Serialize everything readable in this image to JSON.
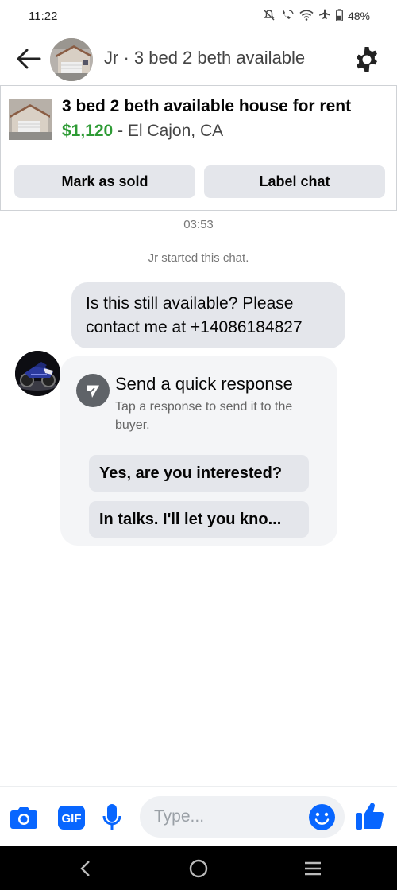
{
  "status_bar": {
    "time": "11:22",
    "battery": "48%"
  },
  "header": {
    "title": "Jr · 3 bed 2 beth available"
  },
  "listing": {
    "title": "3 bed 2 beth available house for rent",
    "price": "$1,120",
    "separator": " - ",
    "location": "El Cajon, CA",
    "mark_sold_label": "Mark as sold",
    "label_chat_label": "Label chat"
  },
  "chat": {
    "timestamp": "03:53",
    "system_message": "Jr started this chat.",
    "outgoing_message": "Is this still available? Please contact me at +14086184827",
    "quick_response": {
      "title": "Send a quick response",
      "subtitle": "Tap a response to send it to the buyer.",
      "replies": [
        "Yes, are you interested?",
        "In talks. I'll let you kno..."
      ]
    }
  },
  "composer": {
    "placeholder": "Type...",
    "gif_label": "GIF"
  },
  "colors": {
    "accent": "#0866ff",
    "price_green": "#2e9b35",
    "bubble_gray": "#e4e6eb"
  }
}
